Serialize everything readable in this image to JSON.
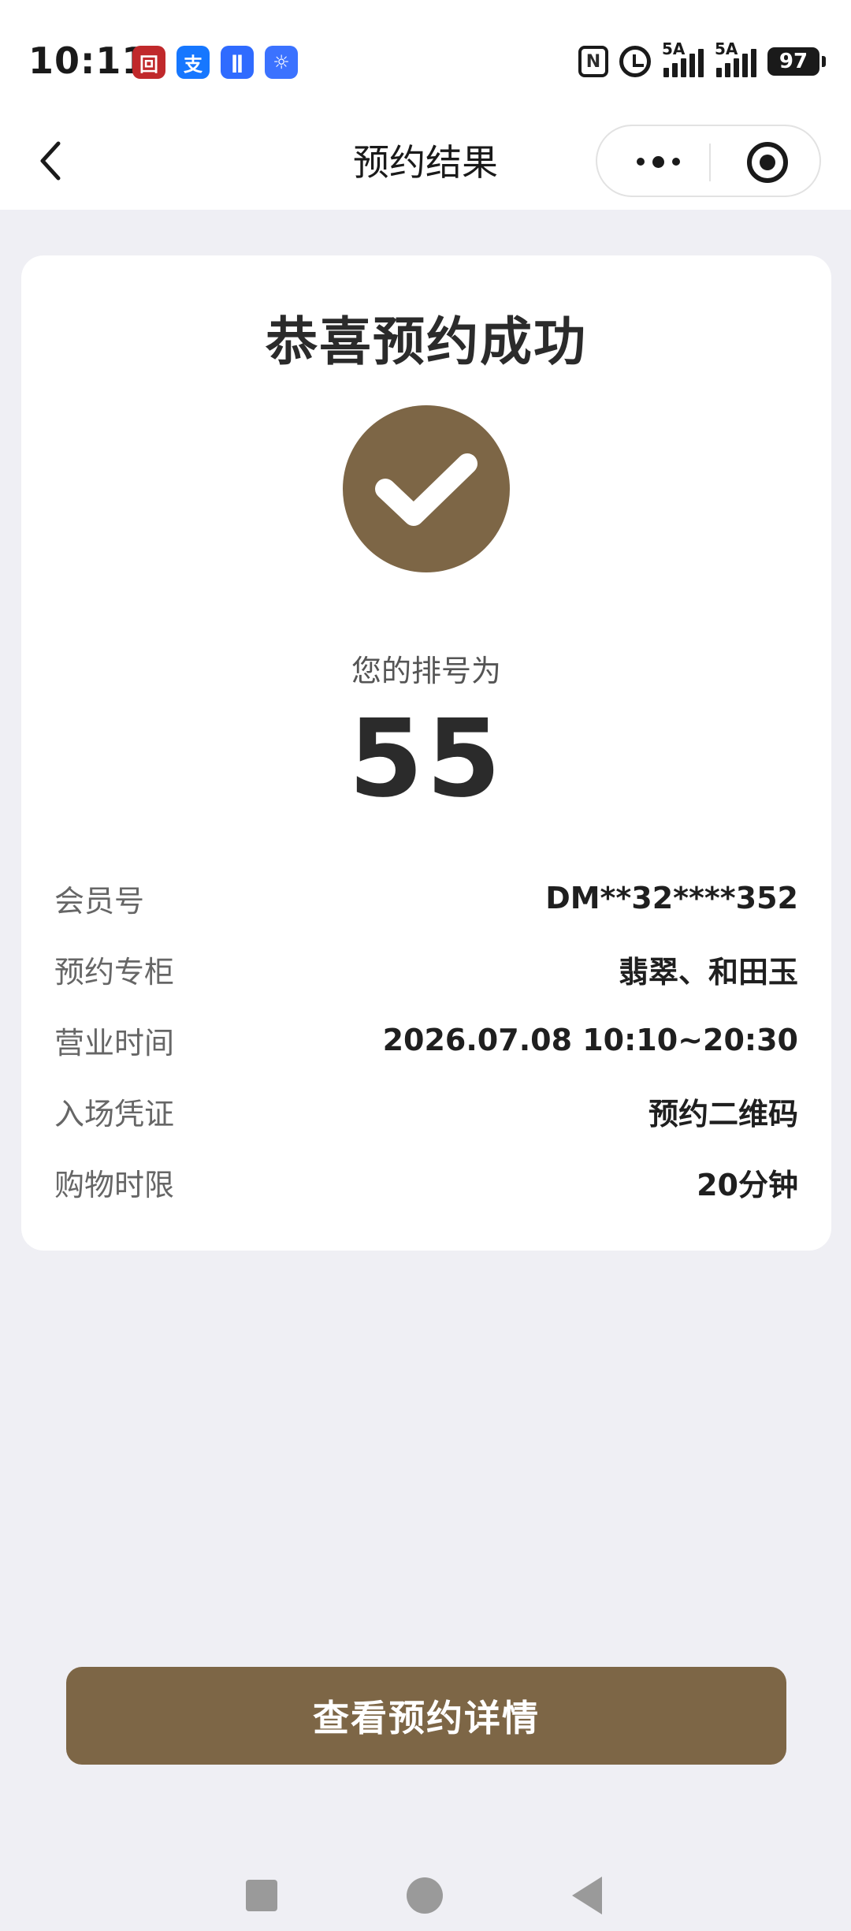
{
  "status_bar": {
    "time": "10:11",
    "app_icons": [
      "bank-icon",
      "alipay-icon",
      "voice-icon",
      "bulb-icon"
    ],
    "app_icon_glyphs": [
      "回",
      "支",
      "ǁ",
      "☼"
    ],
    "network_label_1": "5A",
    "network_label_2": "5A",
    "battery": "97"
  },
  "nav": {
    "title": "预约结果"
  },
  "card": {
    "headline": "恭喜预约成功",
    "queue_label": "您的排号为",
    "queue_number": "55",
    "details": [
      {
        "label": "会员号",
        "value": "DM**32****352"
      },
      {
        "label": "预约专柜",
        "value": "翡翠、和田玉"
      },
      {
        "label": "营业时间",
        "value": "2026.07.08 10:10~20:30"
      },
      {
        "label": "入场凭证",
        "value": "预约二维码"
      },
      {
        "label": "购物时限",
        "value": "20分钟"
      }
    ]
  },
  "cta": {
    "label": "查看预约详情"
  },
  "colors": {
    "accent": "#7d6646",
    "background": "#efeff4",
    "card": "#ffffff"
  }
}
